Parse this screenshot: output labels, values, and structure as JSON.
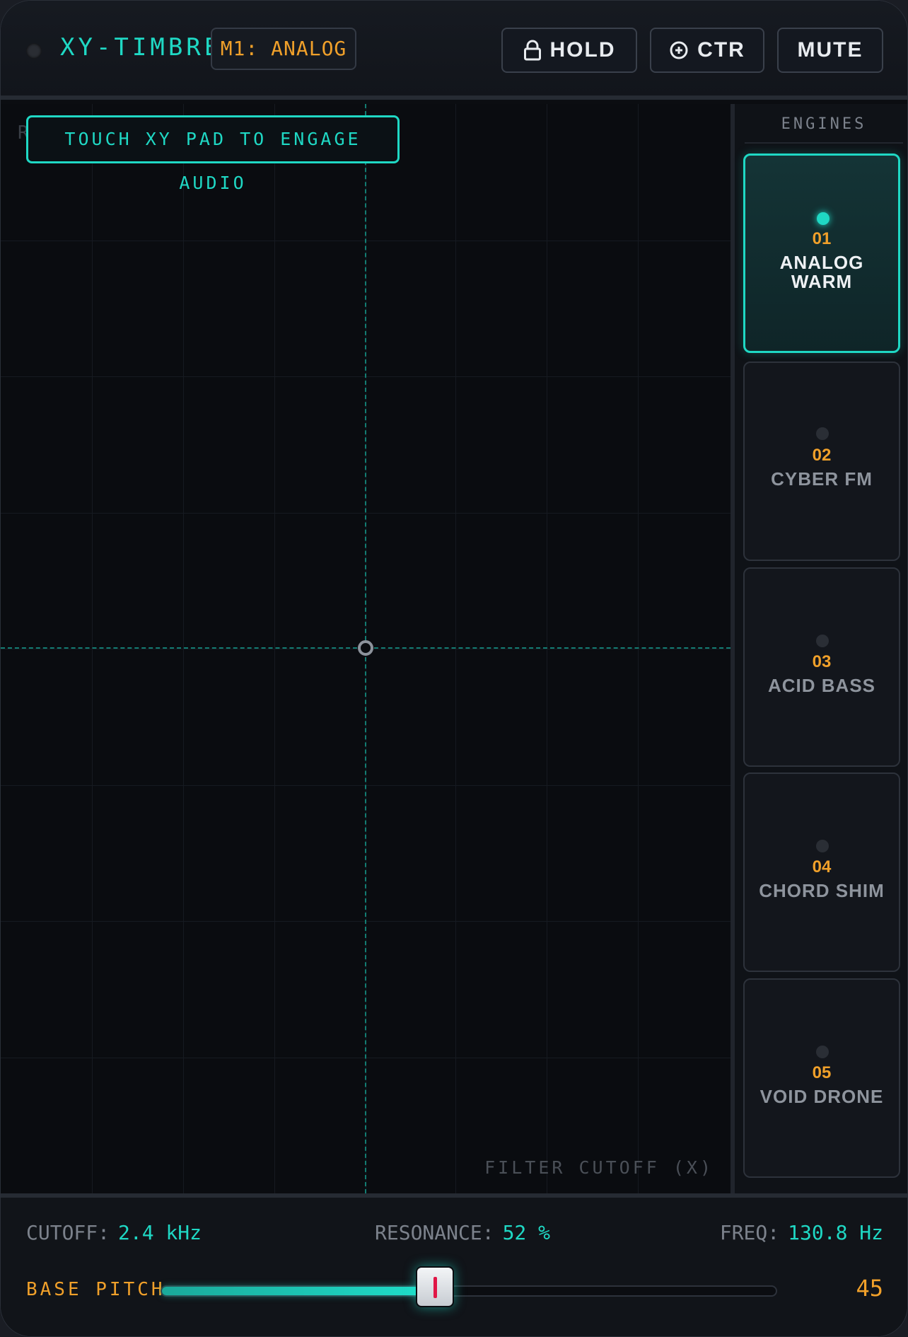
{
  "header": {
    "title": "XY-TIMBRE",
    "mode": "M1: ANALOG",
    "hold_label": "HOLD",
    "ctr_label": "CTR",
    "mute_label": "MUTE"
  },
  "pad": {
    "ghost_label": "R",
    "touch_hint": "TOUCH XY PAD TO ENGAGE AUDIO",
    "x_axis_label": "FILTER CUTOFF (X)"
  },
  "engines": {
    "title": "ENGINES",
    "items": [
      {
        "num": "01",
        "name": "ANALOG WARM",
        "active": true
      },
      {
        "num": "02",
        "name": "CYBER FM",
        "active": false
      },
      {
        "num": "03",
        "name": "ACID BASS",
        "active": false
      },
      {
        "num": "04",
        "name": "CHORD SHIM",
        "active": false
      },
      {
        "num": "05",
        "name": "VOID DRONE",
        "active": false
      }
    ]
  },
  "readouts": {
    "cutoff_label": "CUTOFF:",
    "cutoff_value": "2.4 kHz",
    "resonance_label": "RESONANCE:",
    "resonance_value": "52 %",
    "freq_label": "FREQ:",
    "freq_value": "130.8 Hz"
  },
  "pitch": {
    "label": "BASE PITCH",
    "value": "45",
    "fraction": 0.45
  },
  "colors": {
    "accent": "#1fd8c4",
    "orange": "#f0a02a",
    "thumb_grip": "#e01646"
  }
}
